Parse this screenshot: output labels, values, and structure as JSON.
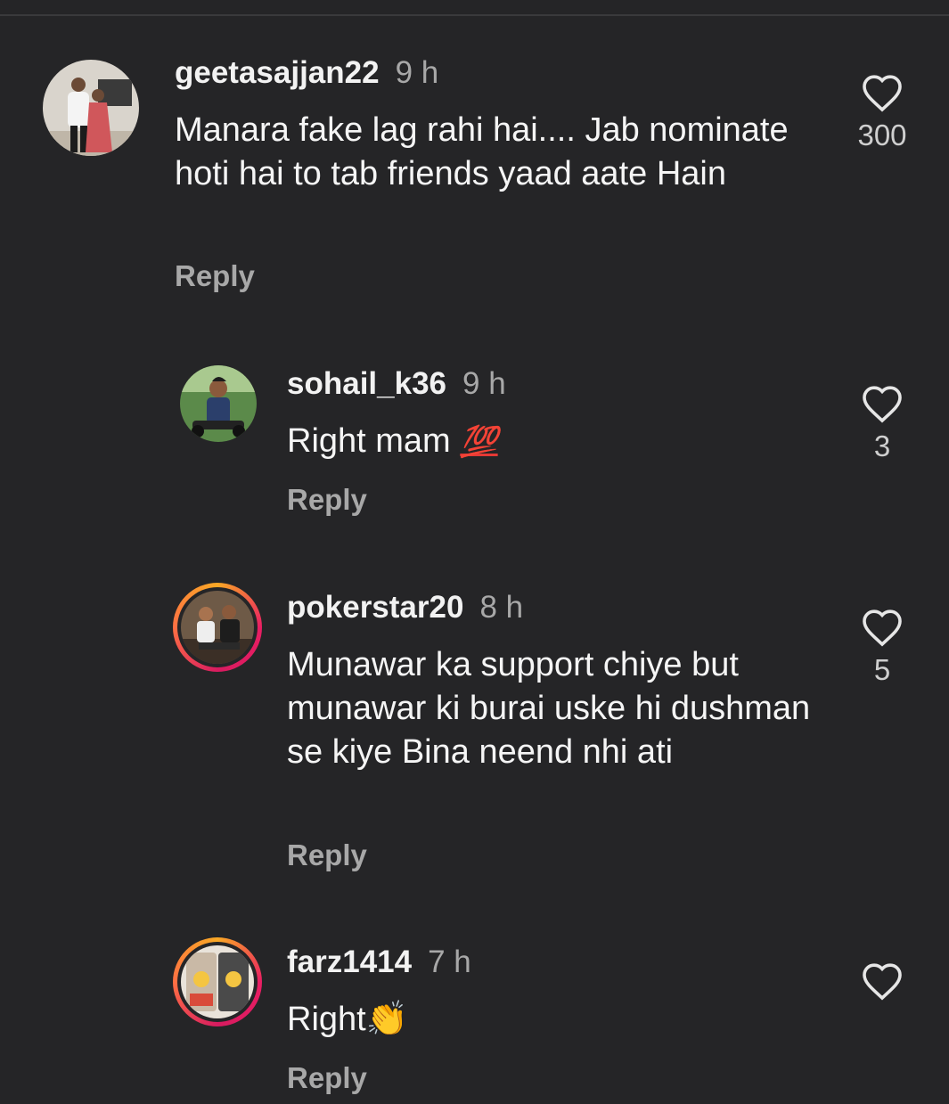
{
  "comments": [
    {
      "username": "geetasajjan22",
      "time": "9 h",
      "text": "Manara fake lag rahi hai.... Jab nominate hoti hai to tab friends yaad aate Hain",
      "reply_label": "Reply",
      "likes": "300"
    },
    {
      "username": "sohail_k36",
      "time": "9 h",
      "text": "Right mam",
      "emoji": "💯",
      "reply_label": "Reply",
      "likes": "3"
    },
    {
      "username": "pokerstar20",
      "time": "8 h",
      "text": "Munawar ka support chiye but munawar ki burai uske hi dushman se kiye Bina neend nhi ati",
      "reply_label": "Reply",
      "likes": "5"
    },
    {
      "username": "farz1414",
      "time": "7 h",
      "text": "Right",
      "emoji": "👏",
      "reply_label": "Reply",
      "likes": ""
    }
  ],
  "icons": {
    "like": "heart-outline-icon"
  }
}
